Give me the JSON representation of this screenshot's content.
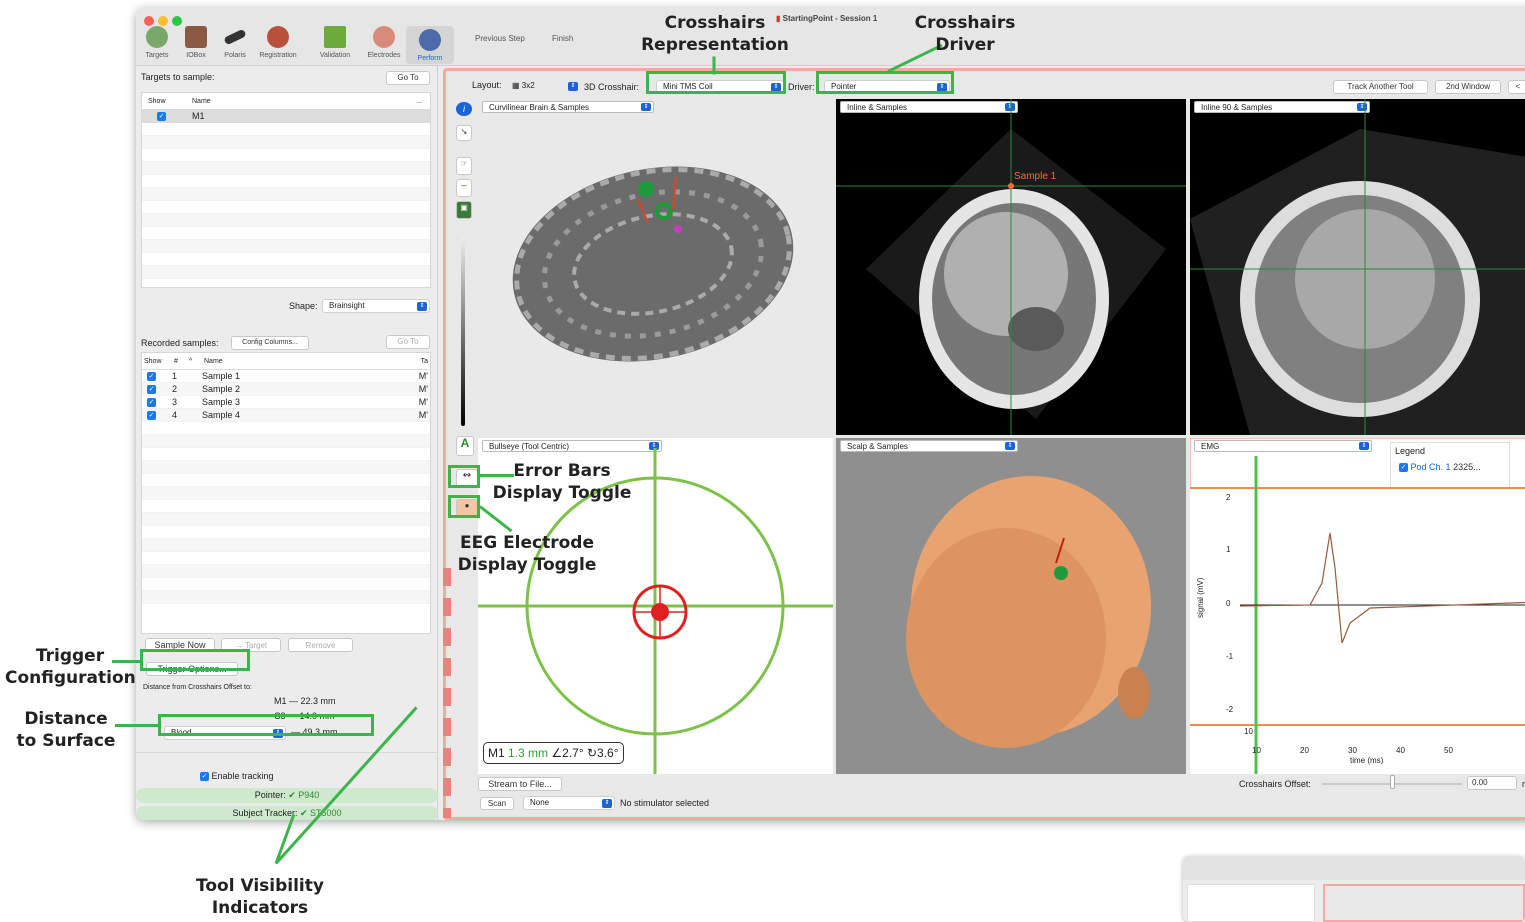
{
  "window": {
    "title": "StartingPoint - Session 1"
  },
  "toolbar": {
    "items": [
      "Targets",
      "IOBox",
      "Polaris",
      "Registration",
      "Validation",
      "Electrodes",
      "Perform"
    ],
    "previous_step": "Previous Step",
    "finish": "Finish"
  },
  "targets": {
    "label": "Targets to sample:",
    "goto": "Go To",
    "col_show": "Show",
    "col_name": "Name",
    "col_more": "...",
    "rows": [
      {
        "name": "M1"
      }
    ],
    "shape_label": "Shape:",
    "shape_value": "Brainsight"
  },
  "recorded": {
    "label": "Recorded samples:",
    "config": "Config Columns...",
    "goto": "Go To",
    "col_show": "Show",
    "col_num": "#",
    "col_sort": "^",
    "col_name": "Name",
    "col_ta": "Ta",
    "rows": [
      {
        "num": "1",
        "name": "Sample 1",
        "ta": "M'"
      },
      {
        "num": "2",
        "name": "Sample 2",
        "ta": "M'"
      },
      {
        "num": "3",
        "name": "Sample 3",
        "ta": "M'"
      },
      {
        "num": "4",
        "name": "Sample 4",
        "ta": "M'"
      }
    ]
  },
  "actions": {
    "sample_now": "Sample Now",
    "to_target": "→ Target",
    "remove": "Remove",
    "trigger_options": "Trigger Options..."
  },
  "distance": {
    "label": "Distance from Crosshairs Offset to:",
    "m1": "M1 — 22.3 mm",
    "c3": "C3 — 14.0 mm",
    "surface": "Blood",
    "surface_val": "— 49.3 mm"
  },
  "tracking": {
    "enable": "Enable tracking",
    "pointer": "Pointer:",
    "pointer_val": "✔ P940",
    "subject": "Subject Tracker:",
    "subject_val": "✔ ST5000"
  },
  "viewbar": {
    "layout_label": "Layout:",
    "layout_value": "3x2",
    "crosshair_label": "3D Crosshair:",
    "crosshair_value": "Mini TMS Coil",
    "driver_label": "Driver:",
    "driver_value": "Pointer",
    "track_another": "Track Another Tool",
    "second_window": "2nd Window",
    "more": "<"
  },
  "panels": {
    "p1": "Curvilinear Brain & Samples",
    "p2": "Inline & Samples",
    "p3": "Inline 90 & Samples",
    "p4": "Bullseye (Tool Centric)",
    "p5": "Scalp & Samples",
    "p6": "EMG",
    "sample_label": "Sample 1"
  },
  "bullseye": {
    "target": "M1",
    "dist": "1.3 mm",
    "angle": "∠2.7°",
    "twist": "↻3.6°"
  },
  "emg": {
    "legend": "Legend",
    "series": "Pod Ch. 1",
    "series_val": "2325...",
    "ylabel": "signal (mV)",
    "xlabel": "time (ms)",
    "yticks": [
      "2",
      "1",
      "0",
      "-1",
      "-2"
    ],
    "xticks": [
      "10",
      "20",
      "30",
      "40",
      "50"
    ],
    "left_tick": "10"
  },
  "bottom": {
    "stream": "Stream to File...",
    "scan": "Scan",
    "stim": "None",
    "stim_status": "No stimulator selected",
    "offset_label": "Crosshairs Offset:",
    "offset_val": "0.00",
    "offset_unit": "m"
  },
  "annotations": {
    "rep": "Crosshairs\nRepresentation",
    "driver": "Crosshairs\nDriver",
    "errbars": "Error Bars\nDisplay Toggle",
    "eeg": "EEG Electrode\nDisplay Toggle",
    "trigger": "Trigger\nConfiguration",
    "distance": "Distance\nto Surface",
    "tools": "Tool Visibility\nIndicators"
  }
}
